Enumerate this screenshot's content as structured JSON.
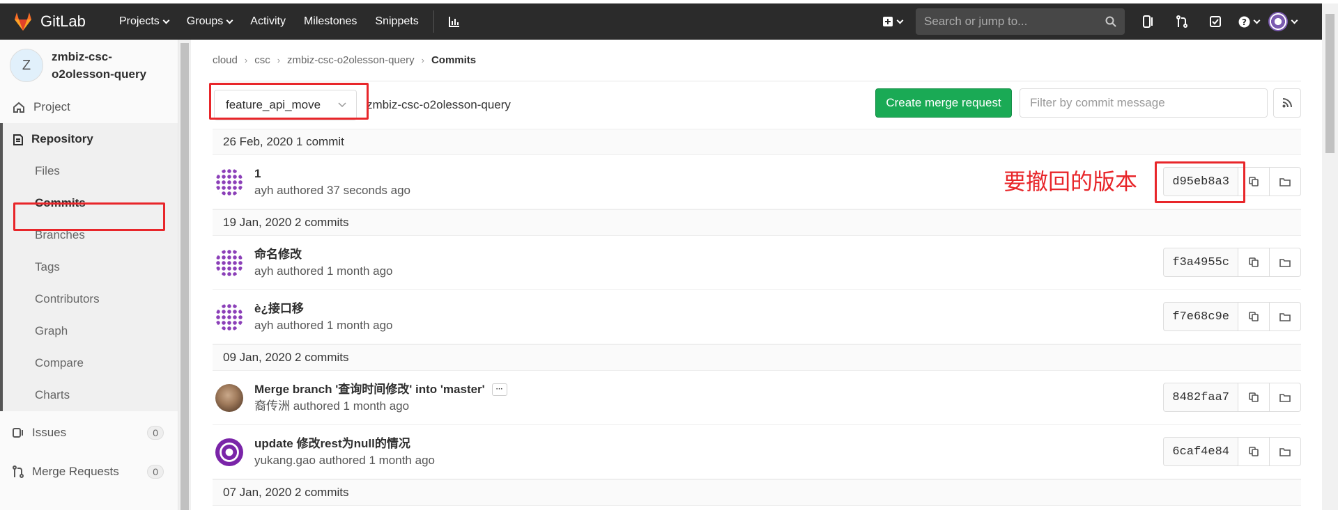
{
  "app": {
    "name": "GitLab"
  },
  "topnav": {
    "items": [
      "Projects",
      "Groups",
      "Activity",
      "Milestones",
      "Snippets"
    ],
    "search_placeholder": "Search or jump to..."
  },
  "sidebar": {
    "project_initial": "Z",
    "project_name": "zmbiz-csc-o2olesson-query",
    "project_label": "Project",
    "repository_label": "Repository",
    "repo_items": [
      "Files",
      "Commits",
      "Branches",
      "Tags",
      "Contributors",
      "Graph",
      "Compare",
      "Charts"
    ],
    "issues_label": "Issues",
    "issues_count": "0",
    "mr_label": "Merge Requests",
    "mr_count": "0"
  },
  "breadcrumb": [
    "cloud",
    "csc",
    "zmbiz-csc-o2olesson-query",
    "Commits"
  ],
  "toolbar": {
    "branch": "feature_api_move",
    "path": "zmbiz-csc-o2olesson-query",
    "create_mr": "Create merge request",
    "filter_placeholder": "Filter by commit message"
  },
  "groups": [
    {
      "date": "26 Feb, 2020 1 commit",
      "commits": [
        {
          "title": "1",
          "meta": "ayh authored 37 seconds ago",
          "sha": "d95eb8a3"
        }
      ]
    },
    {
      "date": "19 Jan, 2020 2 commits",
      "commits": [
        {
          "title": "命名修改",
          "meta": "ayh authored 1 month ago",
          "sha": "f3a4955c"
        },
        {
          "title": "è¿接口移",
          "meta": "ayh authored 1 month ago",
          "sha": "f7e68c9e"
        }
      ]
    },
    {
      "date": "09 Jan, 2020 2 commits",
      "commits": [
        {
          "title": "Merge branch '查询时间修改' into 'master'",
          "meta": "裔传洲 authored 1 month ago",
          "sha": "8482faa7"
        },
        {
          "title": "update 修改rest为null的情况",
          "meta": "yukang.gao authored 1 month ago",
          "sha": "6caf4e84"
        }
      ]
    },
    {
      "date": "07 Jan, 2020 2 commits",
      "commits": []
    }
  ],
  "annotation": "要撤回的版本",
  "colors": {
    "topbar": "#2b2b2b",
    "create_button": "#1aaa55",
    "annotation": "#e8262a"
  }
}
